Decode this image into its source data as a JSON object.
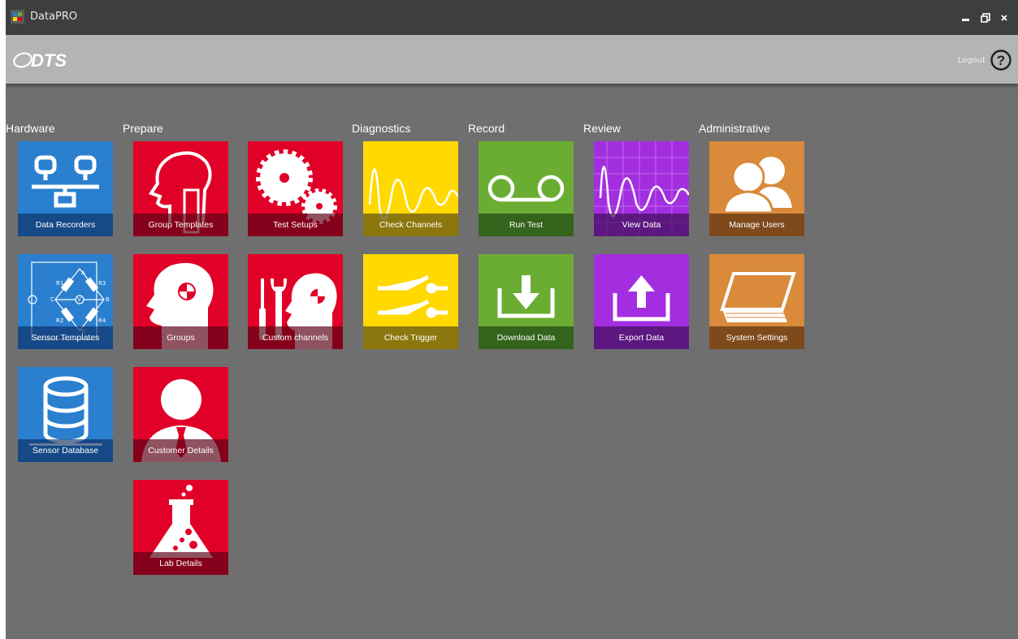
{
  "window": {
    "title": "DataPRO"
  },
  "header": {
    "logo_text": "DTS",
    "logout_label": "Logout",
    "help_glyph": "?"
  },
  "sections": {
    "hardware": "Hardware",
    "prepare": "Prepare",
    "diagnostics": "Diagnostics",
    "record": "Record",
    "review": "Review",
    "administrative": "Administrative"
  },
  "tiles": {
    "data_recorders": "Data Recorders",
    "sensor_templates": "Sensor Templates",
    "sensor_database": "Sensor Database",
    "group_templates": "Group Templates",
    "groups": "Groups",
    "customer_details": "Customer Details",
    "lab_details": "Lab Details",
    "test_setups": "Test Setups",
    "custom_channels": "Custom channels",
    "check_channels": "Check Channels",
    "check_trigger": "Check Trigger",
    "run_test": "Run Test",
    "download_data": "Download Data",
    "view_data": "View Data",
    "export_data": "Export Data",
    "manage_users": "Manage Users",
    "system_settings": "System Settings"
  },
  "sensor_diagram": {
    "labels": [
      "A",
      "B",
      "C",
      "D",
      "V",
      "R1",
      "R2",
      "R3",
      "R4"
    ]
  },
  "colors": {
    "hardware_tile": "#2a7fcf",
    "prepare_tile": "#e10028",
    "diagnostics_tile": "#ffd900",
    "record_tile": "#6bad33",
    "review_tile": "#a32ee0",
    "administrative_tile": "#d98a3a",
    "background": "#6f6f6f",
    "header": "#b4b4b4",
    "titlebar": "#3e3e3e"
  }
}
